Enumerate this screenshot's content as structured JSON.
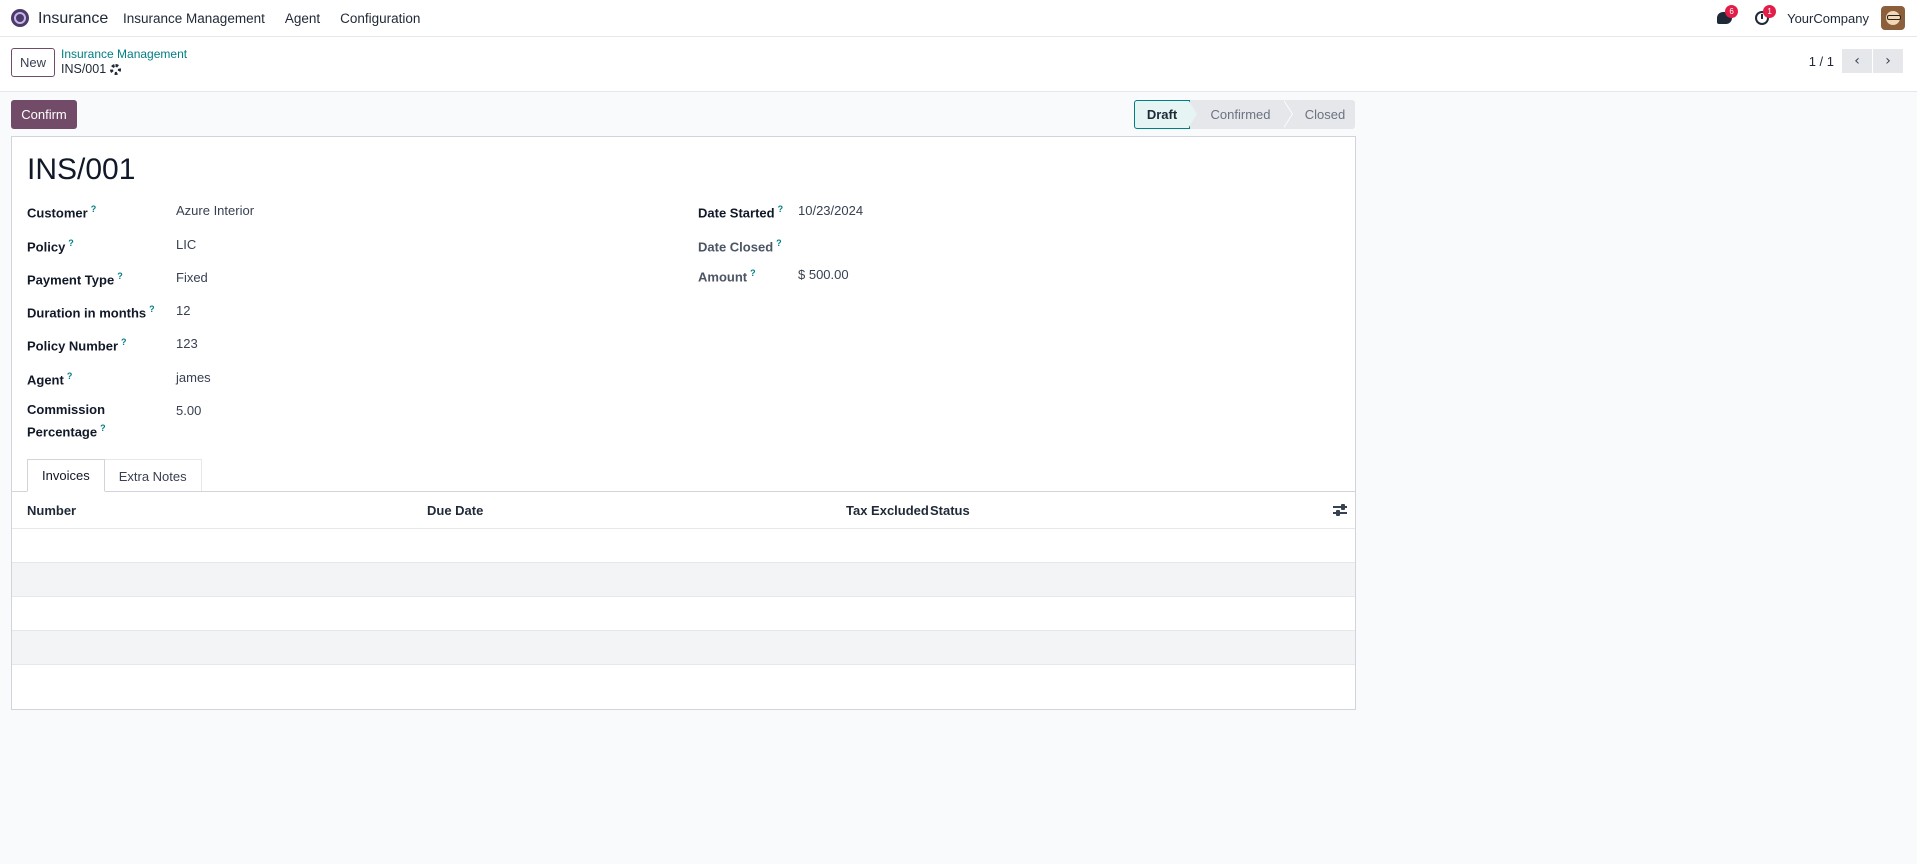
{
  "navbar": {
    "app_icon": "insurance-app-icon",
    "app_name": "Insurance",
    "menu": [
      "Insurance Management",
      "Agent",
      "Configuration"
    ],
    "messages_badge": "6",
    "activities_badge": "1",
    "company": "YourCompany"
  },
  "control_panel": {
    "new_label": "New",
    "breadcrumb_parent": "Insurance Management",
    "breadcrumb_current": "INS/001",
    "pager_value": "1 / 1",
    "pager_prev": "‹",
    "pager_next": "›"
  },
  "actions": {
    "confirm_label": "Confirm"
  },
  "statusbar": {
    "stages": [
      "Draft",
      "Confirmed",
      "Closed"
    ],
    "active": "Draft"
  },
  "form": {
    "title": "INS/001",
    "left_fields": [
      {
        "label": "Customer",
        "value": "Azure Interior"
      },
      {
        "label": "Policy",
        "value": "LIC"
      },
      {
        "label": "Payment Type",
        "value": "Fixed"
      },
      {
        "label": "Duration in months",
        "value": "12"
      },
      {
        "label": "Policy Number",
        "value": "123"
      },
      {
        "label": "Agent",
        "value": "james"
      },
      {
        "label_line1": "Commission",
        "label_line2": "Percentage",
        "value": "5.00"
      }
    ],
    "right_fields": [
      {
        "label": "Date Started",
        "value": "10/23/2024"
      },
      {
        "label": "Date Closed",
        "value": ""
      },
      {
        "label": "Amount",
        "value": "$ 500.00"
      }
    ],
    "help_mark": "?"
  },
  "notebook": {
    "tabs": [
      "Invoices",
      "Extra Notes"
    ],
    "active": "Invoices",
    "columns": [
      "Number",
      "Due Date",
      "Tax Excluded",
      "Status"
    ]
  },
  "colors": {
    "brand": "#714b67",
    "accent": "#017e84",
    "badge": "#e11d48"
  }
}
